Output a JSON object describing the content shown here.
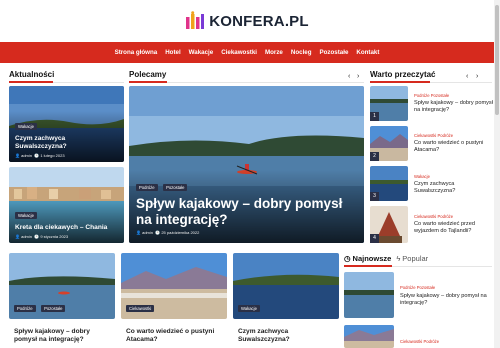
{
  "header": {
    "logo_text": "KONFERA.PL"
  },
  "nav": [
    "Strona główna",
    "Hotel",
    "Wakacje",
    "Ciekawostki",
    "Morze",
    "Nocleg",
    "Pozostałe",
    "Kontakt"
  ],
  "sections": {
    "news": "Aktualności",
    "recommended": "Polecamy",
    "worth_reading": "Warto przeczytać"
  },
  "controls": {
    "prev": "‹",
    "next": "›"
  },
  "news_cards": [
    {
      "tags": [
        "Wakacje"
      ],
      "title": "Czym zachwyca Suwalszczyzna?",
      "author": "admin",
      "date": "1 lutego 2023"
    },
    {
      "tags": [
        "Wakacje"
      ],
      "title": "Kreta dla ciekawych – Chania",
      "author": "admin",
      "date": "9 stycznia 2023"
    }
  ],
  "featured": {
    "tags": [
      "Podróże",
      "Pozostałe"
    ],
    "title": "Spływ kajakowy – dobry pomysł na integrację?",
    "author": "admin",
    "date": "25 października 2022"
  },
  "worth_reading": [
    {
      "num": "1",
      "tag": "Podróże  Pozostałe",
      "title": "Spływ kajakowy – dobry pomysł na integrację?"
    },
    {
      "num": "2",
      "tag": "Ciekawostki  Podróże",
      "title": "Co warto wiedzieć o pustyni Atacama?"
    },
    {
      "num": "3",
      "tag": "Wakacje",
      "title": "Czym zachwyca Suwalszczyzna?"
    },
    {
      "num": "4",
      "tag": "Ciekawostki  Podróże",
      "title": "Co warto wiedzieć przed wyjazdem do Tajlandii?"
    }
  ],
  "bottom_cards": [
    {
      "tags": [
        "Podróże",
        "Pozostałe"
      ],
      "title": "Spływ kajakowy – dobry pomysł na integrację?"
    },
    {
      "tags": [
        "Ciekawostki"
      ],
      "title": "Co warto wiedzieć o pustyni Atacama?"
    },
    {
      "tags": [
        "Wakacje"
      ],
      "title": "Czym zachwyca Suwalszczyzna?"
    }
  ],
  "tabs": {
    "latest": "Najnowsze",
    "popular": "Popular"
  },
  "latest_list": [
    {
      "tag": "Podróże  Pozostałe",
      "title": "Spływ kajakowy – dobry pomysł na integrację?"
    },
    {
      "tag": "Ciekawostki  Podróże",
      "title": ""
    }
  ],
  "colors": {
    "accent": "#d62a1e",
    "tag_dark": "#2b3046"
  }
}
